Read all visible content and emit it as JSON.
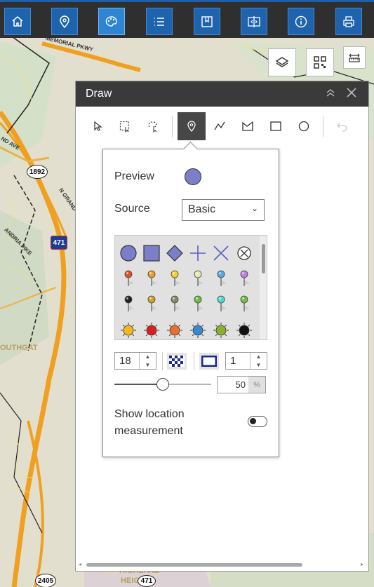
{
  "toolbar": {
    "buttons": [
      {
        "name": "home-icon"
      },
      {
        "name": "location-pin-icon"
      },
      {
        "name": "draw-palette-icon",
        "active": true
      },
      {
        "name": "list-icon"
      },
      {
        "name": "bookmark-icon"
      },
      {
        "name": "compare-icon"
      },
      {
        "name": "info-icon"
      },
      {
        "name": "print-icon"
      }
    ],
    "accent": "#1e63ad"
  },
  "map": {
    "labels": {
      "parkway": "MEMORIAL PKWY",
      "ave": "ND AVE",
      "granda": "N GRAND",
      "pike": "ANDRIA PIKE",
      "southgate": "OUTHGAT",
      "highland": "HIGHLAND",
      "heights": "HEIGHTS"
    },
    "shields": {
      "r1892": "1892",
      "i471": "471",
      "r2405": "2405",
      "r471b": "471"
    }
  },
  "draw": {
    "title": "Draw",
    "preview_label": "Preview",
    "source_label": "Source",
    "source_value": "Basic",
    "size_value": "18",
    "outline_width_value": "1",
    "opacity_value": "50",
    "opacity_unit": "%",
    "opacity_fraction": 0.5,
    "show_measurement_label": "Show location measurement",
    "preview_color": "#7b7fc8",
    "toggle_on": false
  }
}
